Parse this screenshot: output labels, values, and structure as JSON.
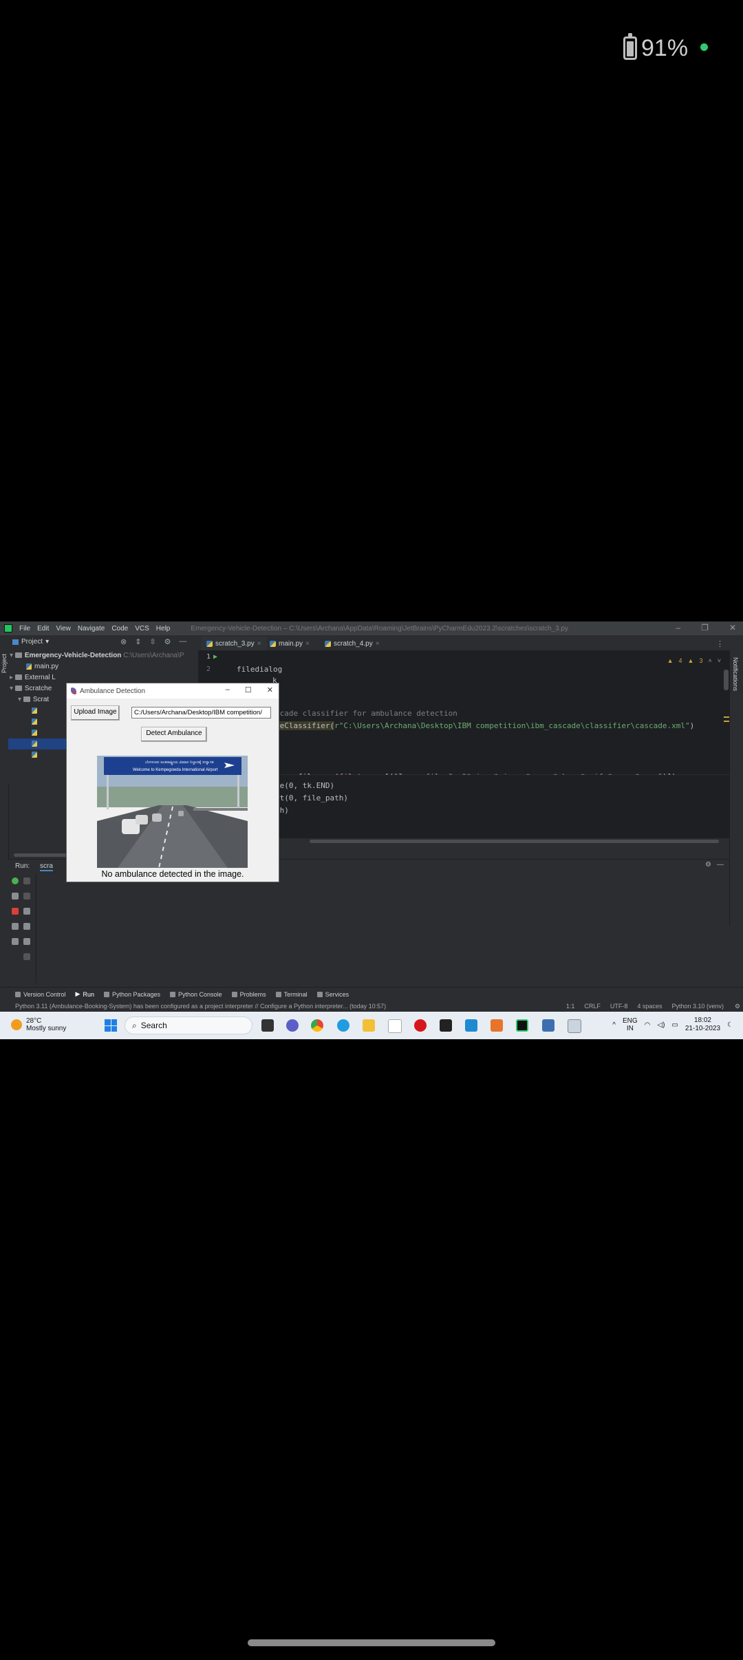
{
  "status_bar": {
    "battery": "91%",
    "battery_level": 0.91,
    "dot_color": "#2ecc71"
  },
  "ide": {
    "menu": [
      "File",
      "Edit",
      "View",
      "Navigate",
      "Code",
      "VCS",
      "Help"
    ],
    "window_title": "Emergency-Vehicle-Detection – C:\\Users\\Archana\\AppData\\Roaming\\JetBrains\\PyCharmEdu2023.2\\scratches\\scratch_3.py",
    "project_label": "Project",
    "side_label_project": "Project",
    "side_label_notifications": "Notifications",
    "tabs": [
      {
        "label": "scratch_3.py",
        "active": true
      },
      {
        "label": "main.py",
        "active": false
      },
      {
        "label": "scratch_4.py",
        "active": false
      }
    ],
    "tree": {
      "root": "Emergency-Vehicle-Detection",
      "root_path": "C:\\Users\\Archana\\P",
      "main_file": "main.py",
      "external": "External L",
      "scratches": "Scratche",
      "scratches_child": "Scrat"
    },
    "warnings": {
      "warn": "4",
      "weak": "3"
    },
    "code": {
      "line1": "",
      "line2": "filedialog",
      "line2b": "k",
      "line3": "scade classifier for ambulance detection",
      "line4a": "deClassifier(",
      "line4b": "r\"C:\\Users\\Archana\\Desktop\\IBM competition\\ibm_cascade\\classifier\\cascade.xml\"",
      "line4c": ")",
      "line5a": "kopenfilename(",
      "line5b": "filetypes",
      "line5c": "=[(",
      "line5d": "\"Image files\", \"*.jpg *.jpeg *.png *.bmp *.gif *.ppm *.pgm\"",
      "line5e": ")])",
      "line6": "te(0, tk.END)",
      "line7": "rt(0, file_path)",
      "line8": "th)"
    },
    "gutter": [
      "1",
      "2"
    ],
    "run_label": "Run:",
    "run_tab": "scra",
    "bottom_tabs": [
      "Version Control",
      "Run",
      "Python Packages",
      "Python Console",
      "Problems",
      "Terminal",
      "Services"
    ],
    "status_message": "Python 3.11 (Ambulance-Booking-System) has been configured as a project interpreter // Configure a Python interpreter... (today 10:57)",
    "status_right": [
      "1:1",
      "CRLF",
      "UTF-8",
      "4 spaces",
      "Python 3.10 (venv)"
    ]
  },
  "dialog": {
    "title": "Ambulance Detection",
    "upload_button": "Upload Image",
    "path_value": "C:/Users/Archana/Desktop/IBM competition/",
    "detect_button": "Detect Ambulance",
    "sign_line1": "ಬೆಂಗಳೂರು ಅಂತರಾಷ್ಟ್ರೀಯ ವಿಮಾನ ನಿಲ್ದಾಣಕ್ಕೆ ಸುಸ್ವಾಗತ",
    "sign_line2": "Welcome to Kempegowda International Airport",
    "result": "No ambulance detected in the image."
  },
  "taskbar": {
    "temperature": "28°C",
    "weather": "Mostly sunny",
    "search": "Search",
    "lang1": "ENG",
    "lang2": "IN",
    "time": "18:02",
    "date": "21-10-2023"
  }
}
